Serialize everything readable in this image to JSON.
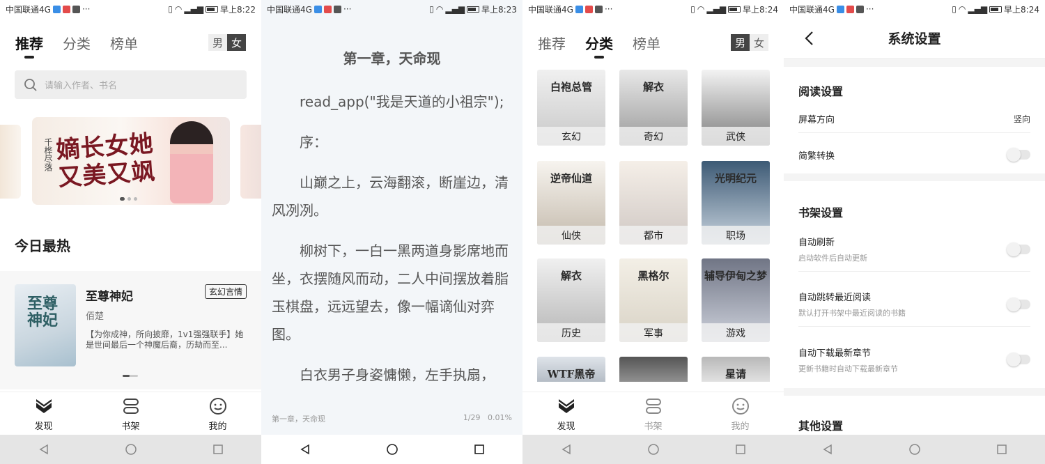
{
  "status_bars": [
    {
      "carrier": "中国联通4G",
      "time": "早上8:22",
      "signal": "⁴ᴳ"
    },
    {
      "carrier": "中国联通4G",
      "time": "早上8:23",
      "signal": "⁴ᴳ"
    },
    {
      "carrier": "中国联通4G",
      "time": "早上8:24",
      "signal": "⁴ᴳ"
    },
    {
      "carrier": "中国联通4G",
      "time": "早上8:24",
      "signal": "⁴ᴳ"
    }
  ],
  "discover": {
    "tabs": [
      "推荐",
      "分类",
      "榜单"
    ],
    "gender": [
      "男",
      "女"
    ],
    "search_placeholder": "请输入作者、书名",
    "section_title": "今日最热",
    "book": {
      "title": "至尊神妃",
      "tag": "玄幻言情",
      "author": "佰楚",
      "desc": "【为你成神，所向披靡，1v1强强联手】她是世间最后一个神魔后裔，历劫而至...",
      "cover_text": "至尊神妃"
    },
    "banner_text": "嫡长女她又美又飒",
    "banner_side_text": "千桦尽落"
  },
  "reader": {
    "chapter_title": "第一章，天命现",
    "paragraphs": [
      "read_app(\"我是天道的小祖宗\");",
      "序：",
      "山巅之上，云海翻滚，断崖边，清风冽冽。",
      "柳树下，一白一黑两道身影席地而坐，衣摆随风而动，二人中间摆放着脂玉棋盘，远远望去，像一幅谪仙对弈图。",
      "白衣男子身姿慵懒，左手执扇，"
    ],
    "footer_chapter": "第一章，天命现",
    "page": "1/29",
    "progress": "0.01%"
  },
  "categories": {
    "items": [
      {
        "label": "玄幻",
        "cover": "白袍总管",
        "colors": [
          "#f0f0f0",
          "#c8c8c8"
        ]
      },
      {
        "label": "奇幻",
        "cover": "解衣",
        "colors": [
          "#e8e8e8",
          "#9a9a9a"
        ]
      },
      {
        "label": "武侠",
        "cover": "",
        "colors": [
          "#f3f3f3",
          "#7d7d7d"
        ]
      },
      {
        "label": "仙侠",
        "cover": "逆帝仙道",
        "colors": [
          "#f7f4ef",
          "#c3b9ab"
        ]
      },
      {
        "label": "都市",
        "cover": "",
        "colors": [
          "#f5efe8",
          "#cfc7c3"
        ]
      },
      {
        "label": "职场",
        "cover": "光明纪元",
        "colors": [
          "#3d5a75",
          "#c9d4df"
        ]
      },
      {
        "label": "历史",
        "cover": "解衣",
        "colors": [
          "#f0f0f0",
          "#b5b5b5"
        ]
      },
      {
        "label": "军事",
        "cover": "黑格尔",
        "colors": [
          "#f3efe6",
          "#d8d2c5"
        ]
      },
      {
        "label": "游戏",
        "cover": "辅导伊甸之梦",
        "colors": [
          "#707585",
          "#cfd3dd"
        ]
      },
      {
        "label": "",
        "cover": "WTF黑帝",
        "colors": [
          "#dfe4ea",
          "#aeb6bf"
        ]
      },
      {
        "label": "",
        "cover": "",
        "colors": [
          "#555555",
          "#9a9a9a"
        ]
      },
      {
        "label": "",
        "cover": "星请",
        "colors": [
          "#b8b8b8",
          "#e8e8e8"
        ]
      }
    ]
  },
  "tabbar": [
    "发现",
    "书架",
    "我的"
  ],
  "settings": {
    "title": "系统设置",
    "sections": [
      {
        "title": "阅读设置",
        "rows": [
          {
            "label": "屏幕方向",
            "sub": "",
            "value": "竖向"
          },
          {
            "label": "简繁转换",
            "sub": "",
            "value": ""
          }
        ]
      },
      {
        "title": "书架设置",
        "rows": [
          {
            "label": "自动刷新",
            "sub": "启动软件后自动更新",
            "value": ""
          },
          {
            "label": "自动跳转最近阅读",
            "sub": "默认打开书架中最近阅读的书籍",
            "value": ""
          },
          {
            "label": "自动下载最新章节",
            "sub": "更新书籍时自动下载最新章节",
            "value": ""
          }
        ]
      },
      {
        "title": "其他设置",
        "rows": []
      }
    ]
  }
}
